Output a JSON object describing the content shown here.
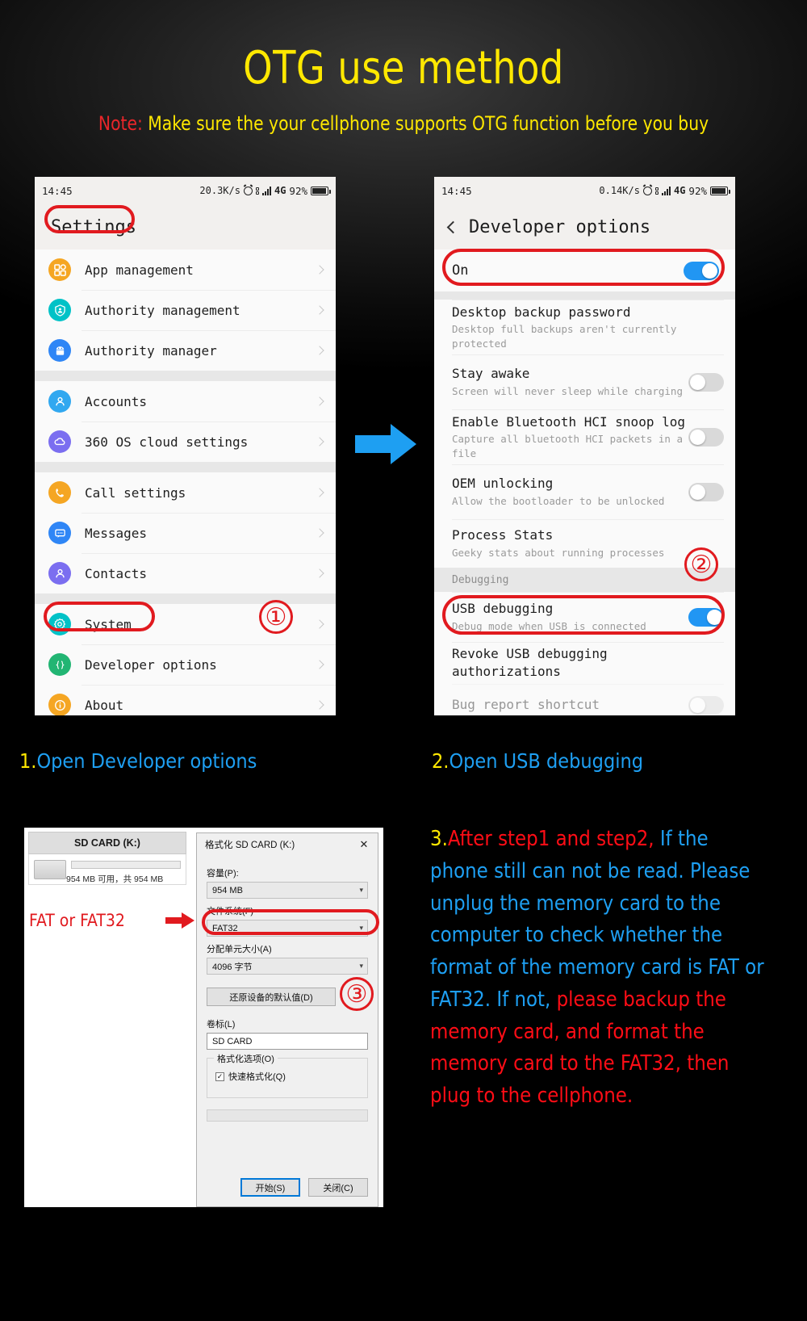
{
  "header": {
    "title": "OTG use method",
    "note_prefix": "Note:",
    "note_text": "Make sure the your cellphone supports OTG function before you buy",
    "title_color": "#ffe800",
    "note_prefix_color": "#e8262a"
  },
  "phone_left": {
    "status": {
      "time": "14:45",
      "speed": "20.3K/s",
      "network": "4G",
      "battery": "92%"
    },
    "app_title": "Settings",
    "groups": [
      {
        "items": [
          {
            "label": "App management",
            "icon": "apps-grid-icon",
            "color": "#f5a623"
          },
          {
            "label": "Authority management",
            "icon": "shield-person-icon",
            "color": "#00c2c7"
          },
          {
            "label": "Authority manager",
            "icon": "android-robot-icon",
            "color": "#2f86f6"
          }
        ]
      },
      {
        "items": [
          {
            "label": "Accounts",
            "icon": "person-icon",
            "color": "#31a8f0"
          },
          {
            "label": "360 OS cloud settings",
            "icon": "cloud-icon",
            "color": "#7b6ef0"
          }
        ]
      },
      {
        "items": [
          {
            "label": "Call settings",
            "icon": "phone-icon",
            "color": "#f5a623"
          },
          {
            "label": "Messages",
            "icon": "message-icon",
            "color": "#2f86f6"
          },
          {
            "label": "Contacts",
            "icon": "contact-icon",
            "color": "#7b6ef0"
          }
        ]
      },
      {
        "items": [
          {
            "label": "System",
            "icon": "gear-icon",
            "color": "#00c2c7"
          },
          {
            "label": "Developer options",
            "icon": "braces-icon",
            "color": "#22b573"
          },
          {
            "label": "About",
            "icon": "info-icon",
            "color": "#f5a623"
          }
        ]
      }
    ],
    "marker": "①"
  },
  "phone_right": {
    "status": {
      "time": "14:45",
      "speed": "0.14K/s",
      "network": "4G",
      "battery": "92%"
    },
    "app_title": "Developer options",
    "master_switch": {
      "label": "On",
      "state": "on"
    },
    "rows": [
      {
        "title": "Desktop backup password",
        "subtitle": "Desktop full backups aren't currently protected",
        "toggle": "none"
      },
      {
        "title": "Stay awake",
        "subtitle": "Screen will never sleep while charging",
        "toggle": "off"
      },
      {
        "title": "Enable Bluetooth HCI snoop log",
        "subtitle": "Capture all bluetooth HCI packets in a file",
        "toggle": "off"
      },
      {
        "title": "OEM unlocking",
        "subtitle": "Allow the bootloader to be unlocked",
        "toggle": "off"
      },
      {
        "title": "Process Stats",
        "subtitle": "Geeky stats about running processes",
        "toggle": "none"
      }
    ],
    "section_header": "Debugging",
    "rows2": [
      {
        "title": "USB debugging",
        "subtitle": "Debug mode when USB is connected",
        "toggle": "on"
      },
      {
        "title": "Revoke USB debugging authorizations",
        "subtitle": "",
        "toggle": "none"
      },
      {
        "title": "Bug report shortcut",
        "subtitle": "",
        "toggle": "off"
      }
    ],
    "marker": "②"
  },
  "captions": {
    "step1_num": "1.",
    "step1_text": "Open Developer options",
    "step2_num": "2.",
    "step2_text": "Open USB debugging"
  },
  "windows": {
    "drive": {
      "name": "SD CARD (K:)",
      "detail": "954 MB 可用，共 954 MB"
    },
    "dialog": {
      "title": "格式化 SD CARD (K:)",
      "close_icon": "close-icon",
      "capacity_label": "容量(P):",
      "capacity_value": "954 MB",
      "filesystem_label": "文件系统(F)",
      "filesystem_value": "FAT32",
      "allocation_label": "分配单元大小(A)",
      "allocation_value": "4096 字节",
      "restore_button": "还原设备的默认值(D)",
      "volume_label": "卷标(L)",
      "volume_value": "SD CARD",
      "options_group": "格式化选项(O)",
      "quick_format": "快速格式化(Q)",
      "quick_format_checked": true,
      "start_button": "开始(S)",
      "close_button": "关闭(C)"
    },
    "fat_note": "FAT or FAT32",
    "marker": "③"
  },
  "step3": {
    "num": "3.",
    "line_red_1": "After step1 and step2,",
    "blue_block": "If the phone still can not be read. Please unplug the memory card to the computer to check whether the format of the memory card is FAT or FAT32.",
    "blue_tail": "If not,",
    "red_block": "please backup the memory card, and format the memory card to the FAT32, then plug to the cellphone."
  },
  "colors": {
    "annotation_red": "#e11a1f",
    "accent_blue": "#1e9ff2",
    "toggle_on": "#2196f3",
    "yellow": "#ffe800"
  }
}
